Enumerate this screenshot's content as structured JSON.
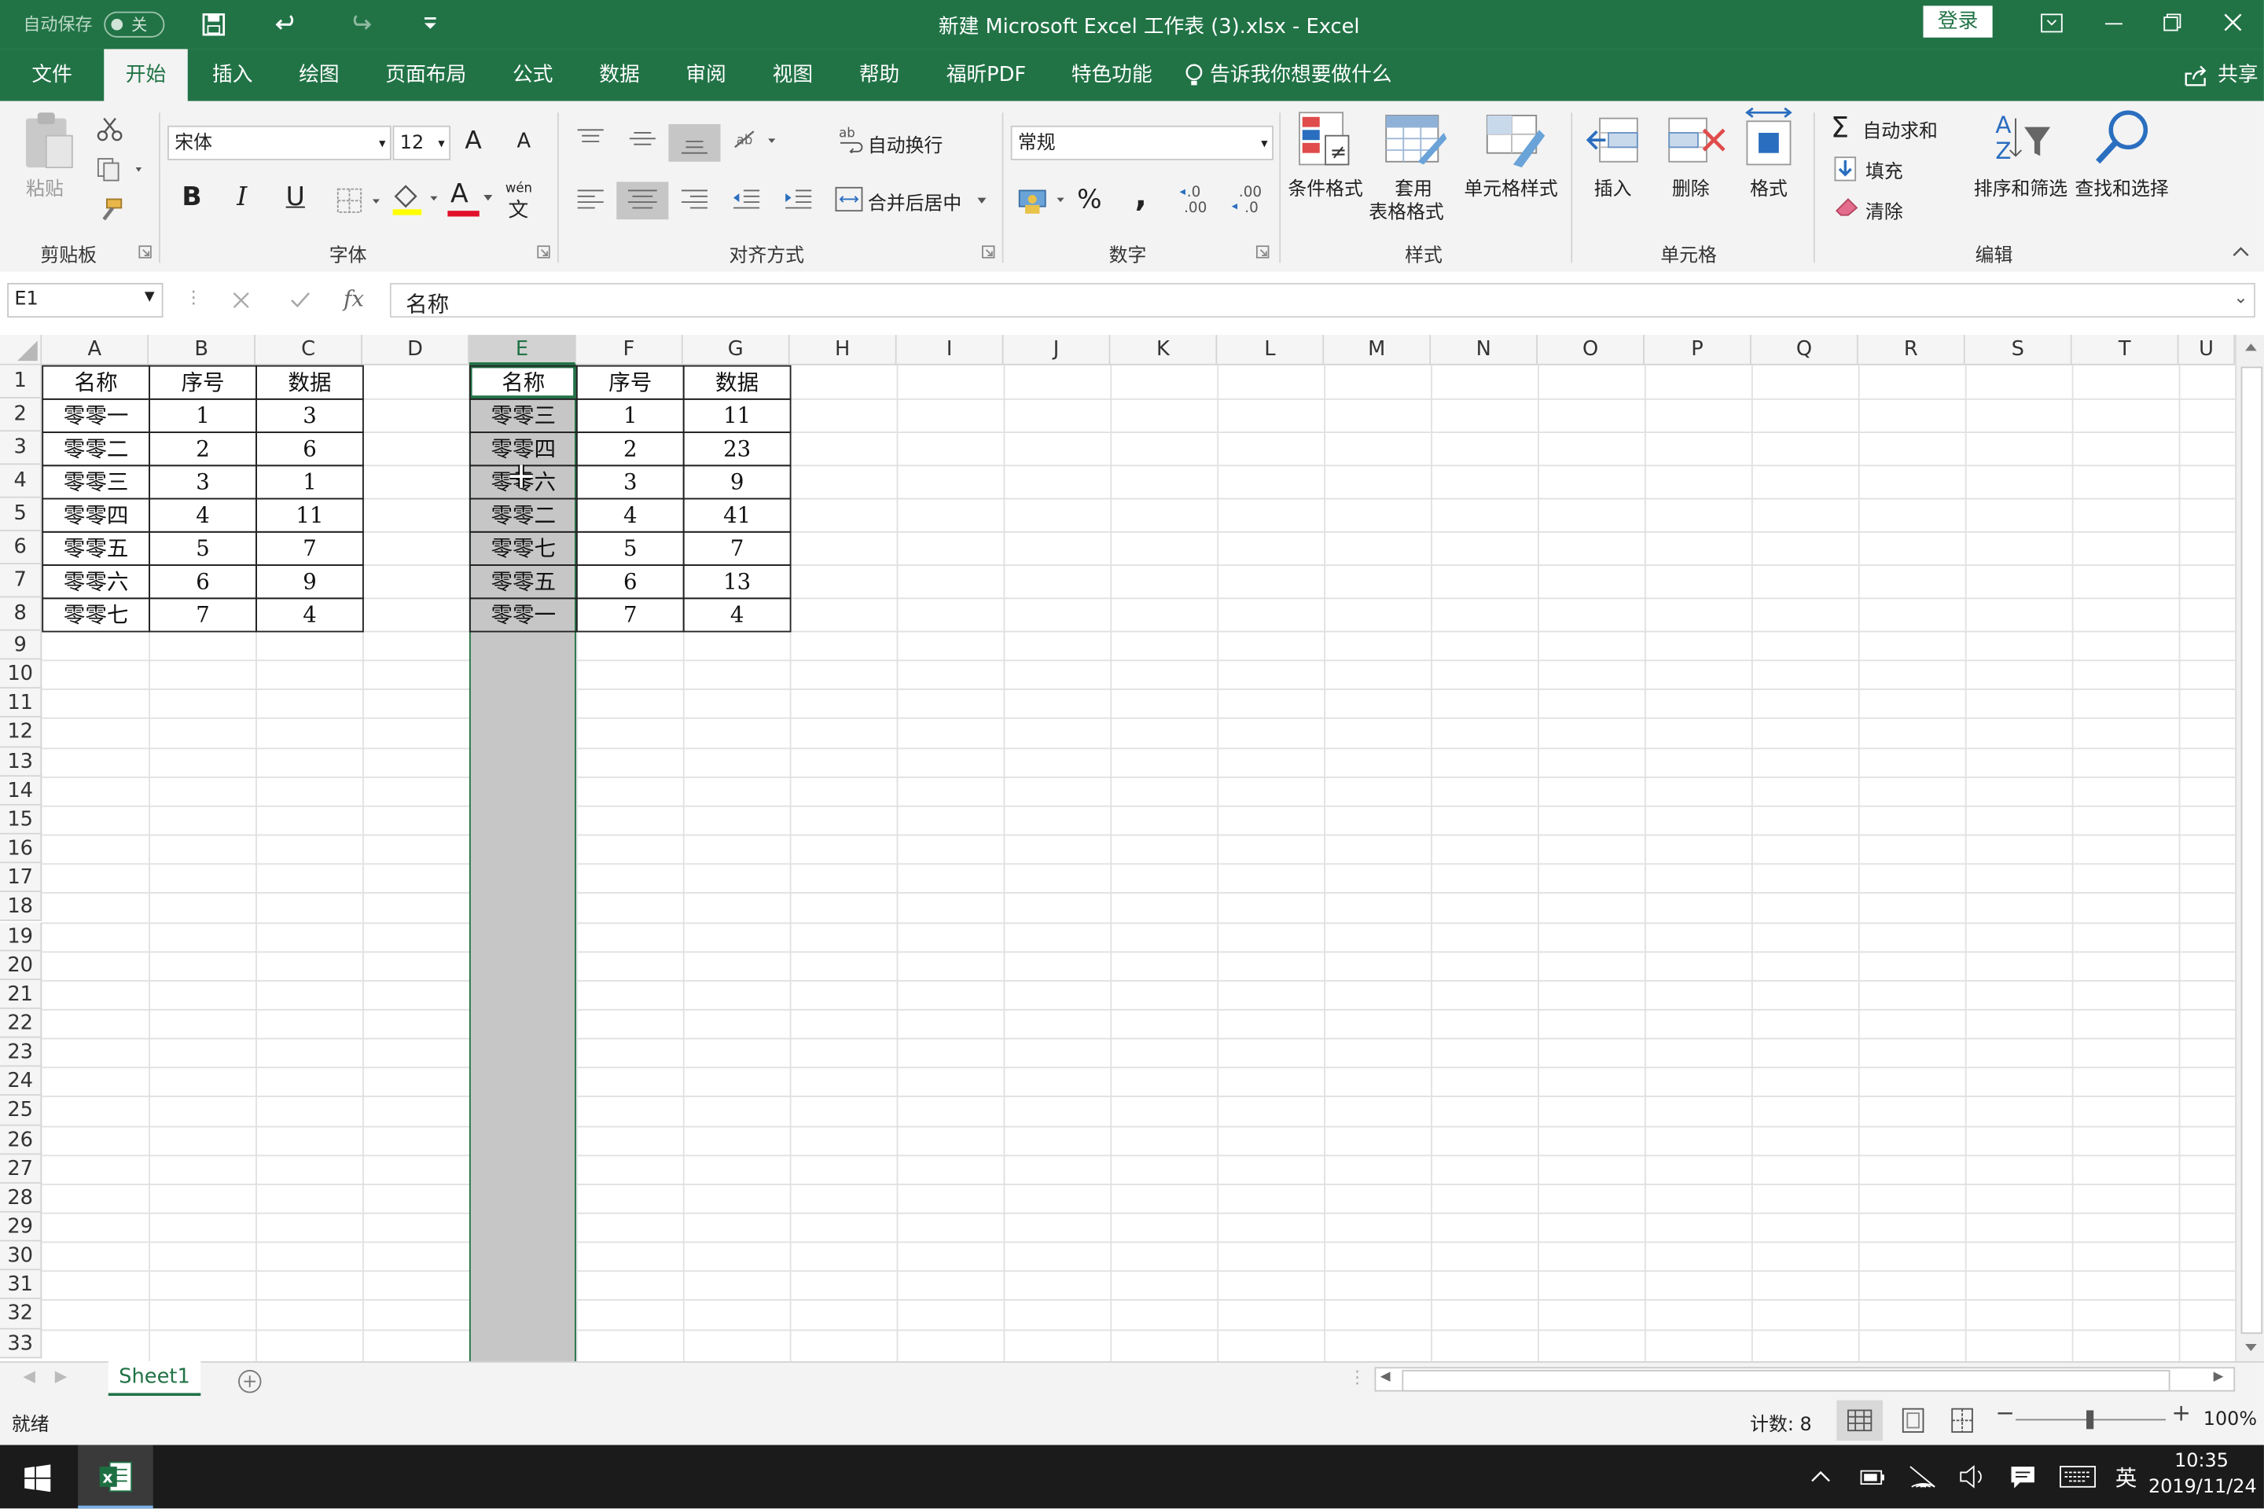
{
  "titlebar": {
    "autosave_label": "自动保存",
    "autosave_state": "关",
    "doc_title": "新建 Microsoft Excel 工作表 (3).xlsx  -  Excel",
    "login_label": "登录"
  },
  "menu": {
    "tabs": [
      "文件",
      "开始",
      "插入",
      "绘图",
      "页面布局",
      "公式",
      "数据",
      "审阅",
      "视图",
      "帮助",
      "福昕PDF",
      "特色功能"
    ],
    "active": "开始",
    "tell_me": "告诉我你想要做什么",
    "share": "共享"
  },
  "ribbon": {
    "clipboard": {
      "paste": "粘贴",
      "group": "剪贴板"
    },
    "font": {
      "name": "宋体",
      "size": "12",
      "bold": "B",
      "italic": "I",
      "underline": "U",
      "phonetic_top": "wén",
      "phonetic_bottom": "文",
      "grow": "A",
      "shrink": "A",
      "font_color": "A",
      "group": "字体"
    },
    "alignment": {
      "wrap": "自动换行",
      "merge": "合并后居中",
      "group": "对齐方式"
    },
    "number": {
      "format": "常规",
      "percent": "%",
      "comma": ",",
      "inc_decimal": "←.0\n.00",
      "dec_decimal": ".00\n→.0",
      "group": "数字"
    },
    "styles": {
      "conditional": "条件格式",
      "table_top": "套用",
      "table_bottom": "表格格式",
      "cell_styles": "单元格样式",
      "group": "样式"
    },
    "cells": {
      "insert": "插入",
      "delete": "删除",
      "format": "格式",
      "group": "单元格"
    },
    "editing": {
      "autosum": "自动求和",
      "fill": "填充",
      "clear": "清除",
      "sort": "排序和筛选",
      "find": "查找和选择",
      "group": "编辑"
    }
  },
  "formula_bar": {
    "name_box": "E1",
    "fx": "fx",
    "content": "名称"
  },
  "sheet": {
    "columns": [
      "A",
      "B",
      "C",
      "D",
      "E",
      "F",
      "G",
      "H",
      "I",
      "J",
      "K",
      "L",
      "M",
      "N",
      "O",
      "P",
      "Q",
      "R",
      "S",
      "T",
      "U"
    ],
    "rows": [
      "1",
      "2",
      "3",
      "4",
      "5",
      "6",
      "7",
      "8",
      "9",
      "10",
      "11",
      "12",
      "13",
      "14",
      "15",
      "16",
      "17",
      "18",
      "19",
      "20",
      "21",
      "22",
      "23",
      "24",
      "25",
      "26",
      "27",
      "28",
      "29",
      "30",
      "31",
      "32",
      "33"
    ],
    "table1": {
      "headers": [
        "名称",
        "序号",
        "数据"
      ],
      "rows": [
        [
          "零零一",
          "1",
          "3"
        ],
        [
          "零零二",
          "2",
          "6"
        ],
        [
          "零零三",
          "3",
          "1"
        ],
        [
          "零零四",
          "4",
          "11"
        ],
        [
          "零零五",
          "5",
          "7"
        ],
        [
          "零零六",
          "6",
          "9"
        ],
        [
          "零零七",
          "7",
          "4"
        ]
      ]
    },
    "table2": {
      "headers": [
        "名称",
        "序号",
        "数据"
      ],
      "rows": [
        [
          "零零三",
          "1",
          "11"
        ],
        [
          "零零四",
          "2",
          "23"
        ],
        [
          "零零六",
          "3",
          "9"
        ],
        [
          "零零二",
          "4",
          "41"
        ],
        [
          "零零七",
          "5",
          "7"
        ],
        [
          "零零五",
          "6",
          "13"
        ],
        [
          "零零一",
          "7",
          "4"
        ]
      ]
    }
  },
  "sheet_tabs": {
    "active": "Sheet1"
  },
  "status": {
    "ready": "就绪",
    "count": "计数: 8",
    "zoom": "100%"
  },
  "taskbar": {
    "ime": "英",
    "time": "10:35",
    "date": "2019/11/24"
  },
  "colors": {
    "excel_green": "#217346",
    "selection_gray": "#c6c6c6",
    "grid_line": "#e1e1e1"
  }
}
